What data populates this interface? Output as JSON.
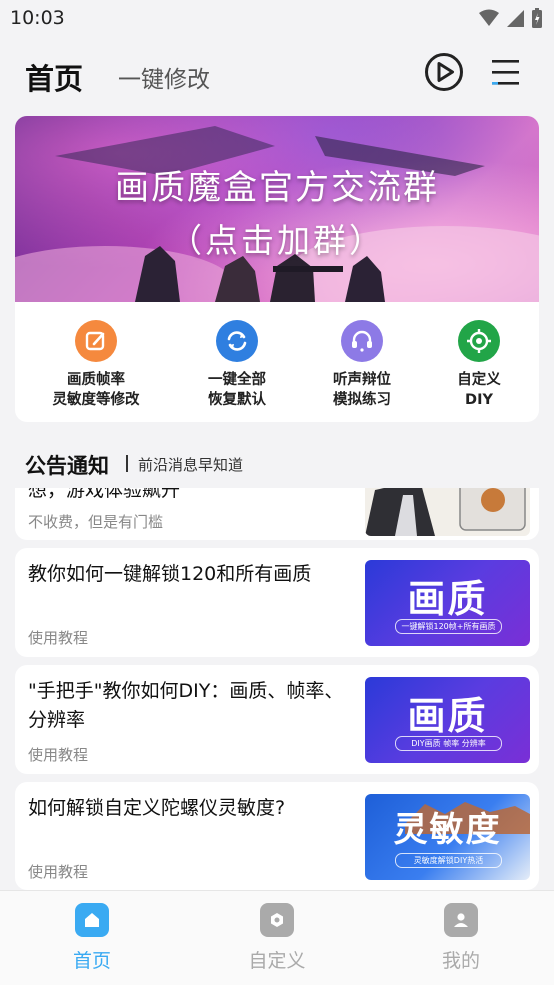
{
  "status_bar": {
    "time": "10:03"
  },
  "header": {
    "tab_home": "首页",
    "tab_oneclick": "一键修改"
  },
  "banner": {
    "title": "画质魔盒官方交流群",
    "subtitle": "（点击加群）"
  },
  "quick_actions": [
    {
      "line1": "画质帧率",
      "line2": "灵敏度等修改",
      "color": "#f5893e",
      "icon": "edit-icon"
    },
    {
      "line1": "一键全部",
      "line2": "恢复默认",
      "color": "#2f7fe0",
      "icon": "refresh-icon"
    },
    {
      "line1": "听声辩位",
      "line2": "模拟练习",
      "color": "#8d7ae6",
      "icon": "headphones-icon"
    },
    {
      "line1": "自定义",
      "line2": "DIY",
      "color": "#22a548",
      "icon": "crosshair-icon"
    }
  ],
  "notice": {
    "title": "公告通知",
    "subtitle": "前沿消息早知道"
  },
  "feed": [
    {
      "title": "想，游戏体验飙升",
      "tag": "不收费，但是有门槛"
    },
    {
      "title": "教你如何一键解锁120和所有画质",
      "tag": "使用教程",
      "thumb_big": "画质",
      "thumb_caption": "一键解锁120帧+所有画质"
    },
    {
      "title": "\"手把手\"教你如何DIY：画质、帧率、分辨率",
      "tag": "使用教程",
      "thumb_big": "画质",
      "thumb_caption": "DIY画质  帧率  分辨率"
    },
    {
      "title": "如何解锁自定义陀螺仪灵敏度?",
      "tag": "使用教程",
      "thumb_big": "灵敏度",
      "thumb_caption": "灵敏度解锁DIY热活"
    }
  ],
  "bottom_nav": [
    {
      "label": "首页",
      "icon": "home-icon",
      "active": true
    },
    {
      "label": "自定义",
      "icon": "hexagon-icon",
      "active": false
    },
    {
      "label": "我的",
      "icon": "profile-icon",
      "active": false
    }
  ],
  "colors": {
    "accent": "#3aaaf2",
    "inactive": "#aaaaaa"
  }
}
